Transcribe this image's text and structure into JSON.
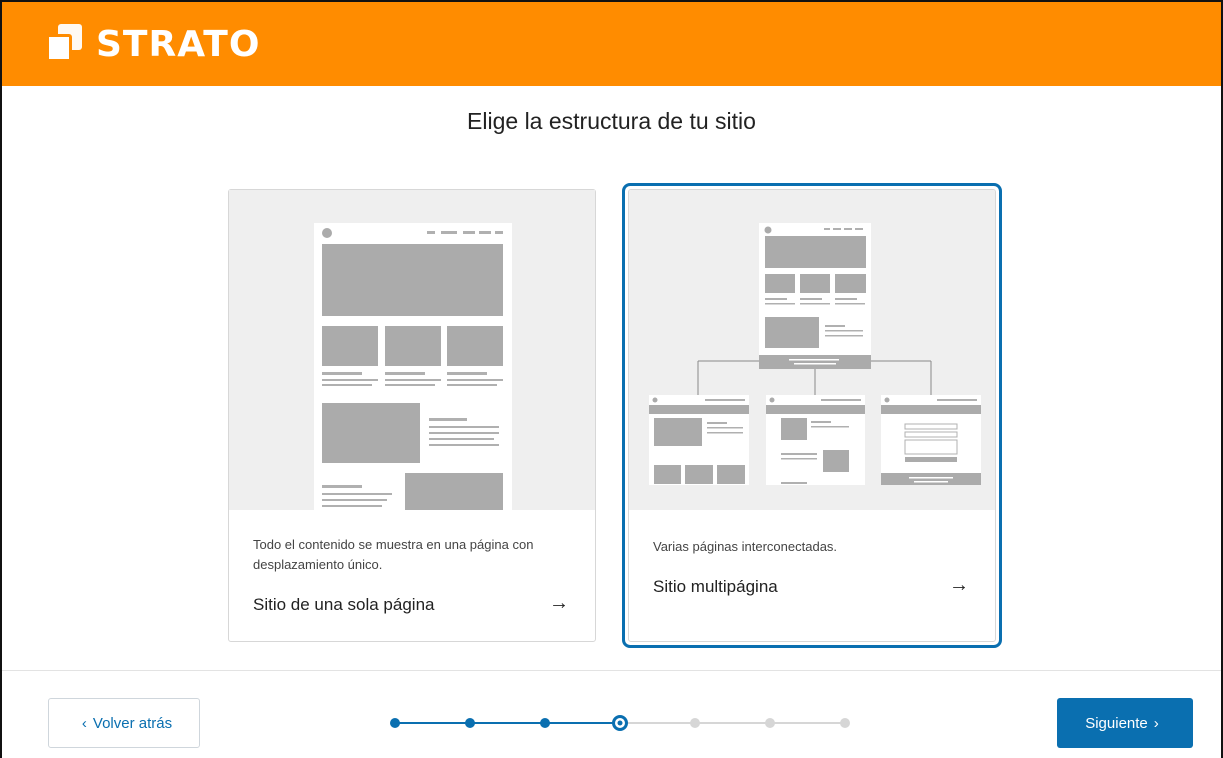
{
  "brand": {
    "name": "STRATO",
    "color": "#ff8c00"
  },
  "page_title": "Elige la estructura de tu sitio",
  "options": [
    {
      "description": "Todo el contenido se muestra en una página con desplazamiento único.",
      "title": "Sitio de una sola página",
      "arrow": "→",
      "selected": false
    },
    {
      "description": "Varias páginas interconectadas.",
      "title": "Sitio multipágina",
      "arrow": "→",
      "selected": true
    }
  ],
  "navigation": {
    "back_label": "Volver atrás",
    "next_label": "Siguiente",
    "back_icon": "chevron-left-icon",
    "next_icon": "chevron-right-icon"
  },
  "progress": {
    "total_steps": 7,
    "current_step": 4
  },
  "colors": {
    "accent": "#0a6fb0",
    "inactive": "#d6d6d6"
  }
}
